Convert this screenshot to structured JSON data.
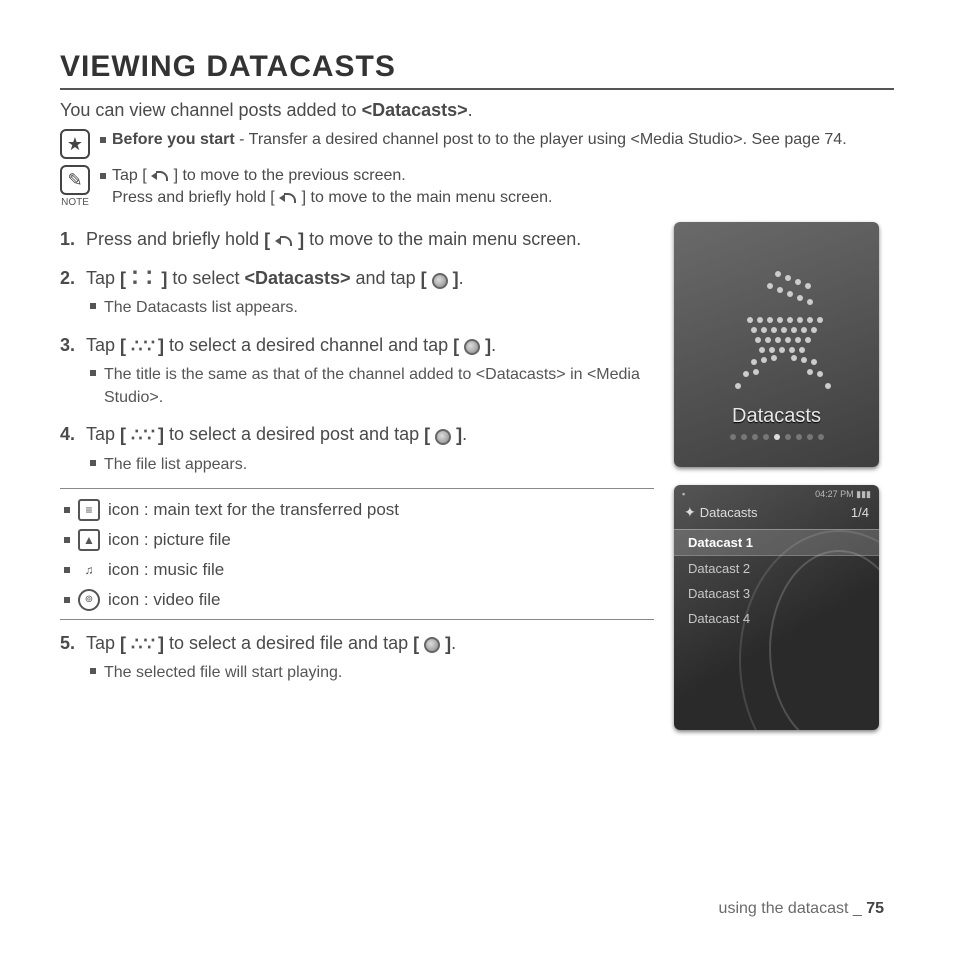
{
  "title": "VIEWING DATACASTS",
  "intro_a": "You can view channel posts added to ",
  "intro_b": "<Datacasts>",
  "intro_c": ".",
  "star_callout": {
    "lead": "Before you start",
    "rest": " - Transfer a desired channel post to to the player using <Media Studio>. See page 74."
  },
  "note_label": "NOTE",
  "note_line1_a": "Tap [ ",
  "note_line1_b": " ] to move to the previous screen.",
  "note_line2_a": "Press and briefly hold [ ",
  "note_line2_b": " ] to move to the main menu screen.",
  "steps": {
    "s1_a": "Press and briefly hold ",
    "s1_b": " to move to the main menu screen.",
    "s2_a": "Tap ",
    "s2_b": " to select ",
    "s2_c": "<Datacasts>",
    "s2_d": " and tap ",
    "s2_e": ".",
    "s2_sub": "The Datacasts list appears.",
    "s3_a": "Tap ",
    "s3_b": " to select a desired channel and tap ",
    "s3_c": ".",
    "s3_sub": "The title is the same as that of the channel added to <Datacasts> in <Media Studio>.",
    "s4_a": "Tap ",
    "s4_b": " to select a desired post and tap ",
    "s4_c": ".",
    "s4_sub": "The file list appears.",
    "s5_a": "Tap ",
    "s5_b": " to select a desired file and tap ",
    "s5_c": ".",
    "s5_sub": "The selected file will start playing."
  },
  "iconlist": {
    "i1": " icon : main text for the transferred post",
    "i2": " icon : picture file",
    "i3": " icon : music file",
    "i4": " icon : video file"
  },
  "device1": {
    "label": "Datacasts"
  },
  "device2": {
    "time": "04:27 PM",
    "page": "1/4",
    "header": "Datacasts",
    "items": [
      "Datacast 1",
      "Datacast 2",
      "Datacast 3",
      "Datacast 4"
    ],
    "selected_index": 0
  },
  "footer": {
    "section": "using the datacast _ ",
    "page": "75"
  }
}
